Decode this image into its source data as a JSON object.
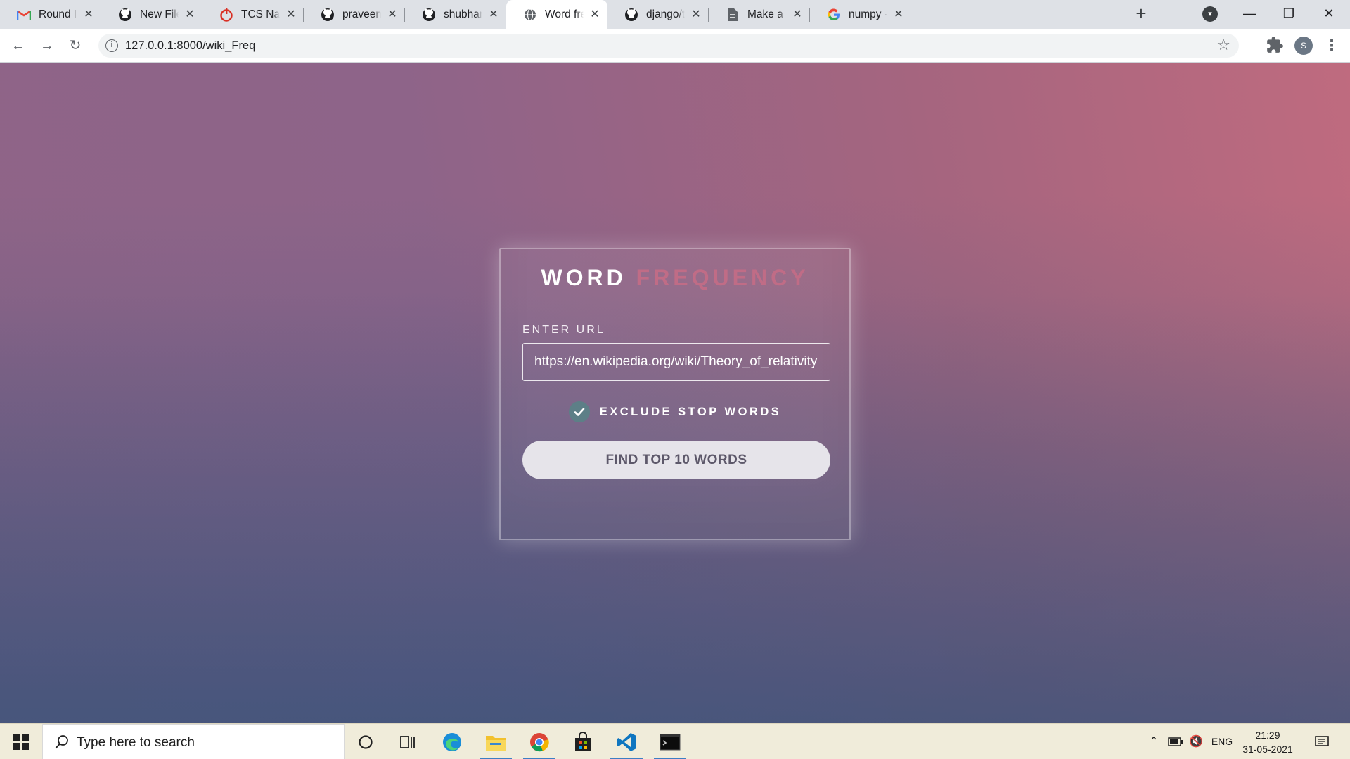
{
  "browser": {
    "tabs": [
      {
        "title": "Round II - Python",
        "favicon": "gmail-icon",
        "active": false
      },
      {
        "title": "New File",
        "favicon": "github-icon",
        "active": false
      },
      {
        "title": "TCS National Qualifier",
        "favicon": "tcs-icon",
        "active": false
      },
      {
        "title": "praveenkumar",
        "favicon": "github-icon",
        "active": false
      },
      {
        "title": "shubhamkumar",
        "favicon": "github-icon",
        "active": false
      },
      {
        "title": "Word frequency",
        "favicon": "globe-icon",
        "active": true
      },
      {
        "title": "django/ticketbooking",
        "favicon": "github-icon",
        "active": false
      },
      {
        "title": "Make a README",
        "favicon": "document-icon",
        "active": false
      },
      {
        "title": "numpy - Google Search",
        "favicon": "google-icon",
        "active": false
      }
    ],
    "new_tab_symbol": "+",
    "close_symbol": "✕",
    "address": "127.0.0.1:8000/wiki_Freq",
    "profile_initial": "S"
  },
  "page": {
    "title_part1": "WORD",
    "title_part2": "FREQUENCY",
    "url_label": "ENTER URL",
    "url_value": "https://en.wikipedia.org/wiki/Theory_of_relativity",
    "checkbox_label": "EXCLUDE STOP WORDS",
    "checkbox_checked": true,
    "submit_label": "FIND TOP 10 WORDS",
    "accent_color": "#c06c86"
  },
  "taskbar": {
    "search_placeholder": "Type here to search",
    "language": "ENG",
    "time": "21:29",
    "date": "31-05-2021"
  }
}
